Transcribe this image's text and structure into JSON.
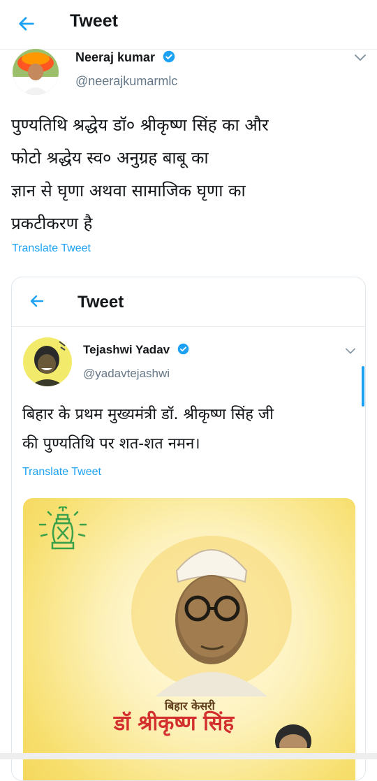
{
  "header": {
    "title": "Tweet"
  },
  "tweet": {
    "author_name": "Neeraj kumar",
    "author_handle": "@neerajkumarmlc",
    "text_lines": [
      "पुण्यतिथि श्रद्धेय डॉ० श्रीकृष्ण सिंह का और",
      "फोटो श्रद्धेय स्व० अनुग्रह बाबू का",
      "ज्ञान से घृणा अथवा सामाजिक घृणा का",
      "प्रकटीकरण है"
    ],
    "translate_label": "Translate Tweet"
  },
  "embedded": {
    "header_title": "Tweet",
    "author_name": "Tejashwi Yadav",
    "author_handle": "@yadavtejashwi",
    "text_lines": [
      "बिहार के प्रथम मुख्यमंत्री डॉ. श्रीकृष्ण सिंह जी",
      "की पुण्यतिथि पर शत-शत नमन।"
    ],
    "translate_label": "Translate Tweet",
    "poster": {
      "subtitle": "बिहार केसरी",
      "title": "डॉ श्रीकृष्ण सिंह"
    }
  },
  "colors": {
    "accent": "#1da1f2",
    "poster_title": "#d32f2f",
    "lantern": "#3aa04a"
  },
  "icons": [
    "back-arrow-icon",
    "verified-badge-icon",
    "chevron-down-icon",
    "lantern-icon"
  ]
}
